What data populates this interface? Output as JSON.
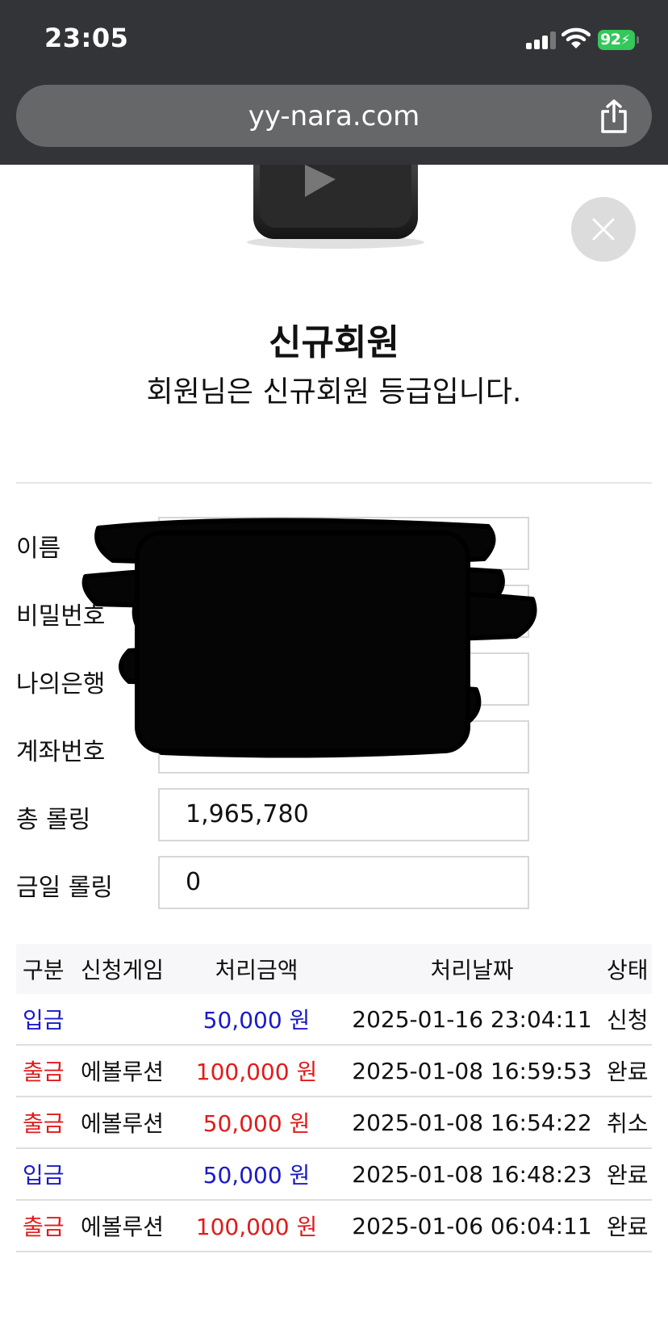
{
  "status_bar": {
    "time": "23:05",
    "battery": "92"
  },
  "browser": {
    "url": "yy-nara.com"
  },
  "grade": {
    "title": "신규회원",
    "description": "회원님은 신규회원 등급입니다."
  },
  "form": {
    "fields": [
      {
        "label": "이름",
        "value": ""
      },
      {
        "label": "비밀번호",
        "value": ""
      },
      {
        "label": "나의은행",
        "value": ""
      },
      {
        "label": "계좌번호",
        "value": ""
      },
      {
        "label": "총 롤링",
        "value": "1,965,780"
      },
      {
        "label": "금일 롤링",
        "value": "0"
      }
    ]
  },
  "history": {
    "headers": [
      "구분",
      "신청게임",
      "처리금액",
      "처리날짜",
      "상태"
    ],
    "rows": [
      {
        "type": "입금",
        "game": "",
        "amount": "50,000 원",
        "date": "2025-01-16 23:04:11",
        "status": "신청"
      },
      {
        "type": "출금",
        "game": "에볼루션",
        "amount": "100,000 원",
        "date": "2025-01-08 16:59:53",
        "status": "완료"
      },
      {
        "type": "출금",
        "game": "에볼루션",
        "amount": "50,000 원",
        "date": "2025-01-08 16:54:22",
        "status": "취소"
      },
      {
        "type": "입금",
        "game": "",
        "amount": "50,000 원",
        "date": "2025-01-08 16:48:23",
        "status": "완료"
      },
      {
        "type": "출금",
        "game": "에볼루션",
        "amount": "100,000 원",
        "date": "2025-01-06 06:04:11",
        "status": "완료"
      }
    ]
  },
  "colors": {
    "deposit": "#1a1ac8",
    "withdraw": "#e01b1b",
    "chrome": "#333438",
    "battery": "#34c759"
  },
  "icons": [
    "wifi-icon",
    "signal-icon",
    "battery-icon",
    "share-icon",
    "close-icon",
    "play-logo-icon"
  ]
}
